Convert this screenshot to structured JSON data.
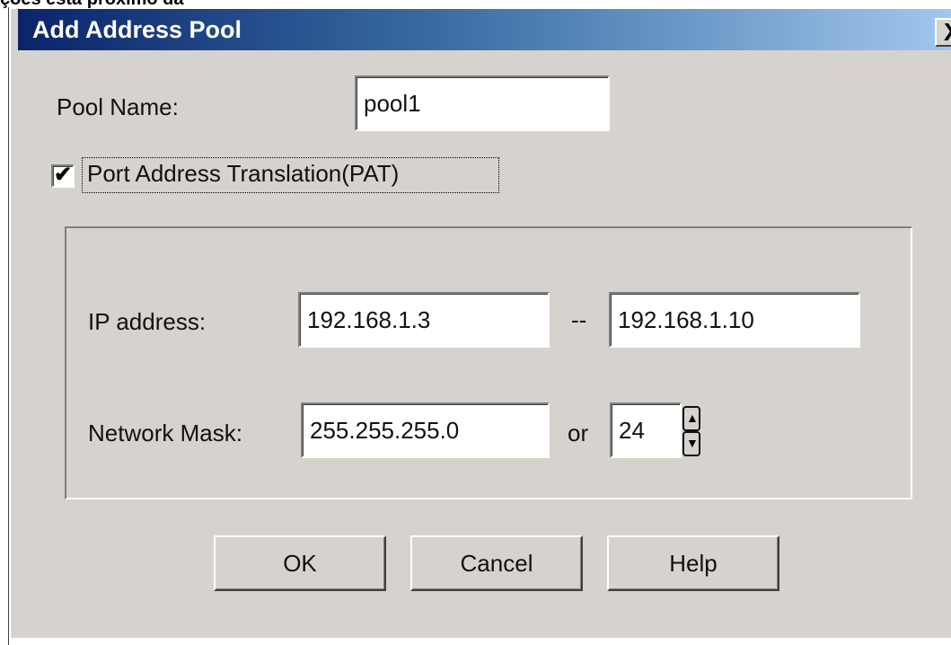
{
  "background_text": "ções está próximo da",
  "window": {
    "title": "Add Address Pool",
    "close_label": "X"
  },
  "pool_name": {
    "label": "Pool Name:",
    "value": "pool1"
  },
  "pat": {
    "label": "Port Address Translation(PAT)",
    "checked": true,
    "check_glyph": "✔"
  },
  "ip_address": {
    "label": "IP address:",
    "start": "192.168.1.3",
    "separator": "--",
    "end": "192.168.1.10"
  },
  "network_mask": {
    "label": "Network Mask:",
    "value": "255.255.255.0",
    "or_label": "or",
    "prefix": "24"
  },
  "buttons": {
    "ok": "OK",
    "cancel": "Cancel",
    "help": "Help"
  },
  "colors": {
    "dialog_bg": "#d6d3ce",
    "titlebar_start": "#0a246a",
    "titlebar_end": "#a6caf0",
    "title_text": "#ffffff"
  },
  "icons": {
    "close": "close-icon",
    "check": "checkmark-icon",
    "spinner_up": "spinner-up-icon",
    "spinner_down": "spinner-down-icon"
  }
}
